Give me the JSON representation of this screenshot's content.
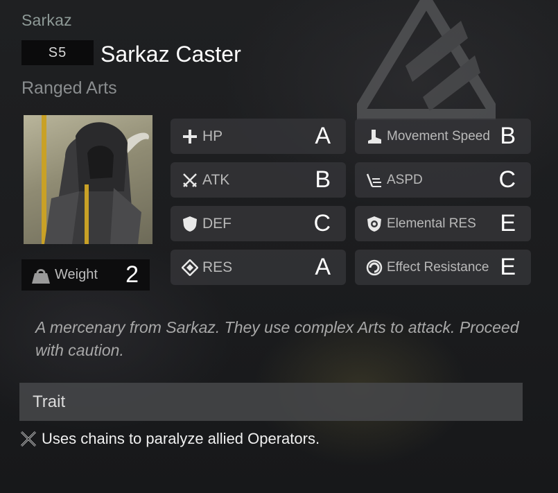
{
  "header": {
    "faction": "Sarkaz",
    "code": "S5",
    "name": "Sarkaz Caster",
    "attack_type": "Ranged Arts"
  },
  "weight": {
    "label": "Weight",
    "value": "2"
  },
  "stats": [
    {
      "label": "HP",
      "grade": "A",
      "icon": "plus-icon"
    },
    {
      "label": "Movement Speed",
      "grade": "B",
      "icon": "boot-icon"
    },
    {
      "label": "ATK",
      "grade": "B",
      "icon": "crossed-swords-icon"
    },
    {
      "label": "ASPD",
      "grade": "C",
      "icon": "speed-lines-icon"
    },
    {
      "label": "DEF",
      "grade": "C",
      "icon": "shield-icon"
    },
    {
      "label": "Elemental RES",
      "grade": "E",
      "icon": "elemental-shield-icon"
    },
    {
      "label": "RES",
      "grade": "A",
      "icon": "diamond-icon"
    },
    {
      "label": "Effect Resistance",
      "grade": "E",
      "icon": "ring-icon"
    }
  ],
  "description": "A mercenary from Sarkaz. They use complex Arts to attack. Proceed with caution.",
  "trait": {
    "title": "Trait",
    "text": "Uses chains to paralyze allied Operators.",
    "icon": "crossed-blades-icon"
  },
  "colors": {
    "panel": "#343538",
    "code_box": "#0b0b0c",
    "trait_bar": "#464749",
    "faction_text": "#8e9a97"
  }
}
